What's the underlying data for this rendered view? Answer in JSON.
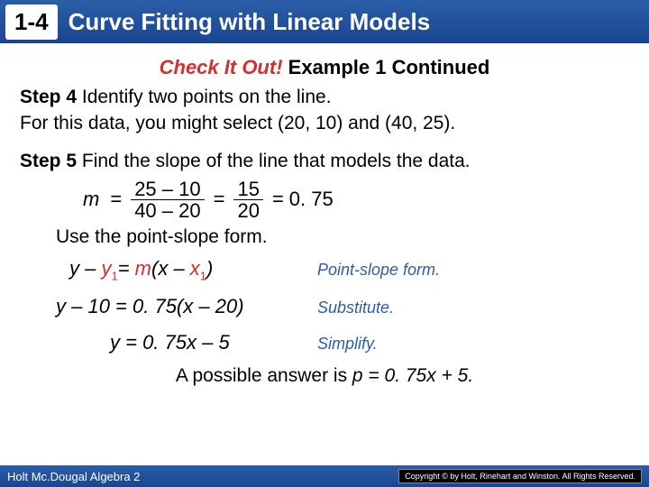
{
  "header": {
    "lesson_number": "1-4",
    "title": "Curve Fitting with Linear Models"
  },
  "subtitle": {
    "red": "Check It Out!",
    "black": " Example 1 Continued"
  },
  "step4": {
    "label": "Step 4",
    "text": " Identify two points on the line.",
    "line2": "For this data, you might select (20, 10) and (40, 25)."
  },
  "step5": {
    "label": "Step 5",
    "text": " Find the slope of the line that models the data."
  },
  "math": {
    "m": "m",
    "eq1": "=",
    "num1": "25 – 10",
    "den1": "40 – 20",
    "eq2": "=",
    "num2": "15",
    "den2": "20",
    "eq3": "=",
    "result": "0. 75"
  },
  "use_point": "Use the point-slope form.",
  "equations": {
    "row1_left_a": "y – ",
    "row1_left_b": "y",
    "row1_left_c": "= ",
    "row1_left_d": "m",
    "row1_left_e": "(",
    "row1_left_f": "x – ",
    "row1_left_g": "x",
    "row1_left_h": ")",
    "row1_sub": "1",
    "row1_right": "Point-slope form.",
    "row2_left": "y – 10 = 0. 75(x – 20)",
    "row2_right": "Substitute.",
    "row3_left": "y = 0. 75x – 5",
    "row3_right": "Simplify."
  },
  "answer": {
    "prefix": "A possible answer is ",
    "eq": "p = 0. 75x + 5."
  },
  "footer": {
    "left": "Holt Mc.Dougal Algebra 2",
    "right": "Copyright © by Holt, Rinehart and Winston. All Rights Reserved."
  }
}
